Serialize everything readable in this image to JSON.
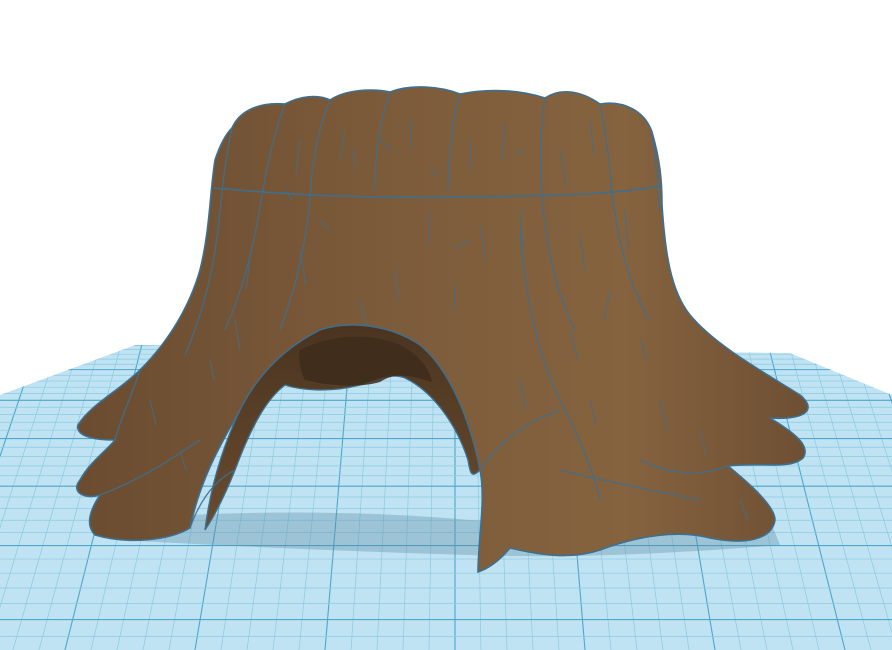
{
  "workspace": {
    "background_color": "#ffffff",
    "grid": {
      "visible": true,
      "plane_color": "#bfe3f2",
      "minor_line_color": "#8cc9e2",
      "major_line_color": "#4fa6cc"
    }
  },
  "model": {
    "name_icon": "tree-stump-with-arch-icon",
    "body_color": "#7a5a3a",
    "shadow_color": "#5e4329",
    "highlight_color": "#8f6c48",
    "edge_color": "#3f6f8e"
  }
}
